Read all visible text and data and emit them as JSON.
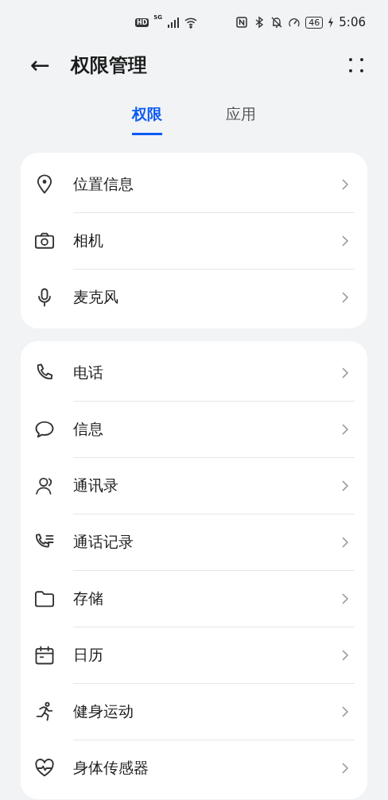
{
  "status_bar": {
    "hd_label": "HD",
    "network_label": "5G",
    "battery": "46",
    "time": "5:06"
  },
  "header": {
    "back": "←",
    "title": "权限管理"
  },
  "tabs": [
    {
      "label": "权限",
      "selected": true
    },
    {
      "label": "应用",
      "selected": false
    }
  ],
  "groups": [
    {
      "items": [
        {
          "kind": "location",
          "label": "位置信息"
        },
        {
          "kind": "camera",
          "label": "相机"
        },
        {
          "kind": "microphone",
          "label": "麦克风"
        }
      ]
    },
    {
      "items": [
        {
          "kind": "phone",
          "label": "电话"
        },
        {
          "kind": "message",
          "label": "信息"
        },
        {
          "kind": "contacts",
          "label": "通讯录"
        },
        {
          "kind": "calllog",
          "label": "通话记录"
        },
        {
          "kind": "storage",
          "label": "存储"
        },
        {
          "kind": "calendar",
          "label": "日历"
        },
        {
          "kind": "fitness",
          "label": "健身运动"
        },
        {
          "kind": "sensor",
          "label": "身体传感器"
        }
      ]
    }
  ]
}
